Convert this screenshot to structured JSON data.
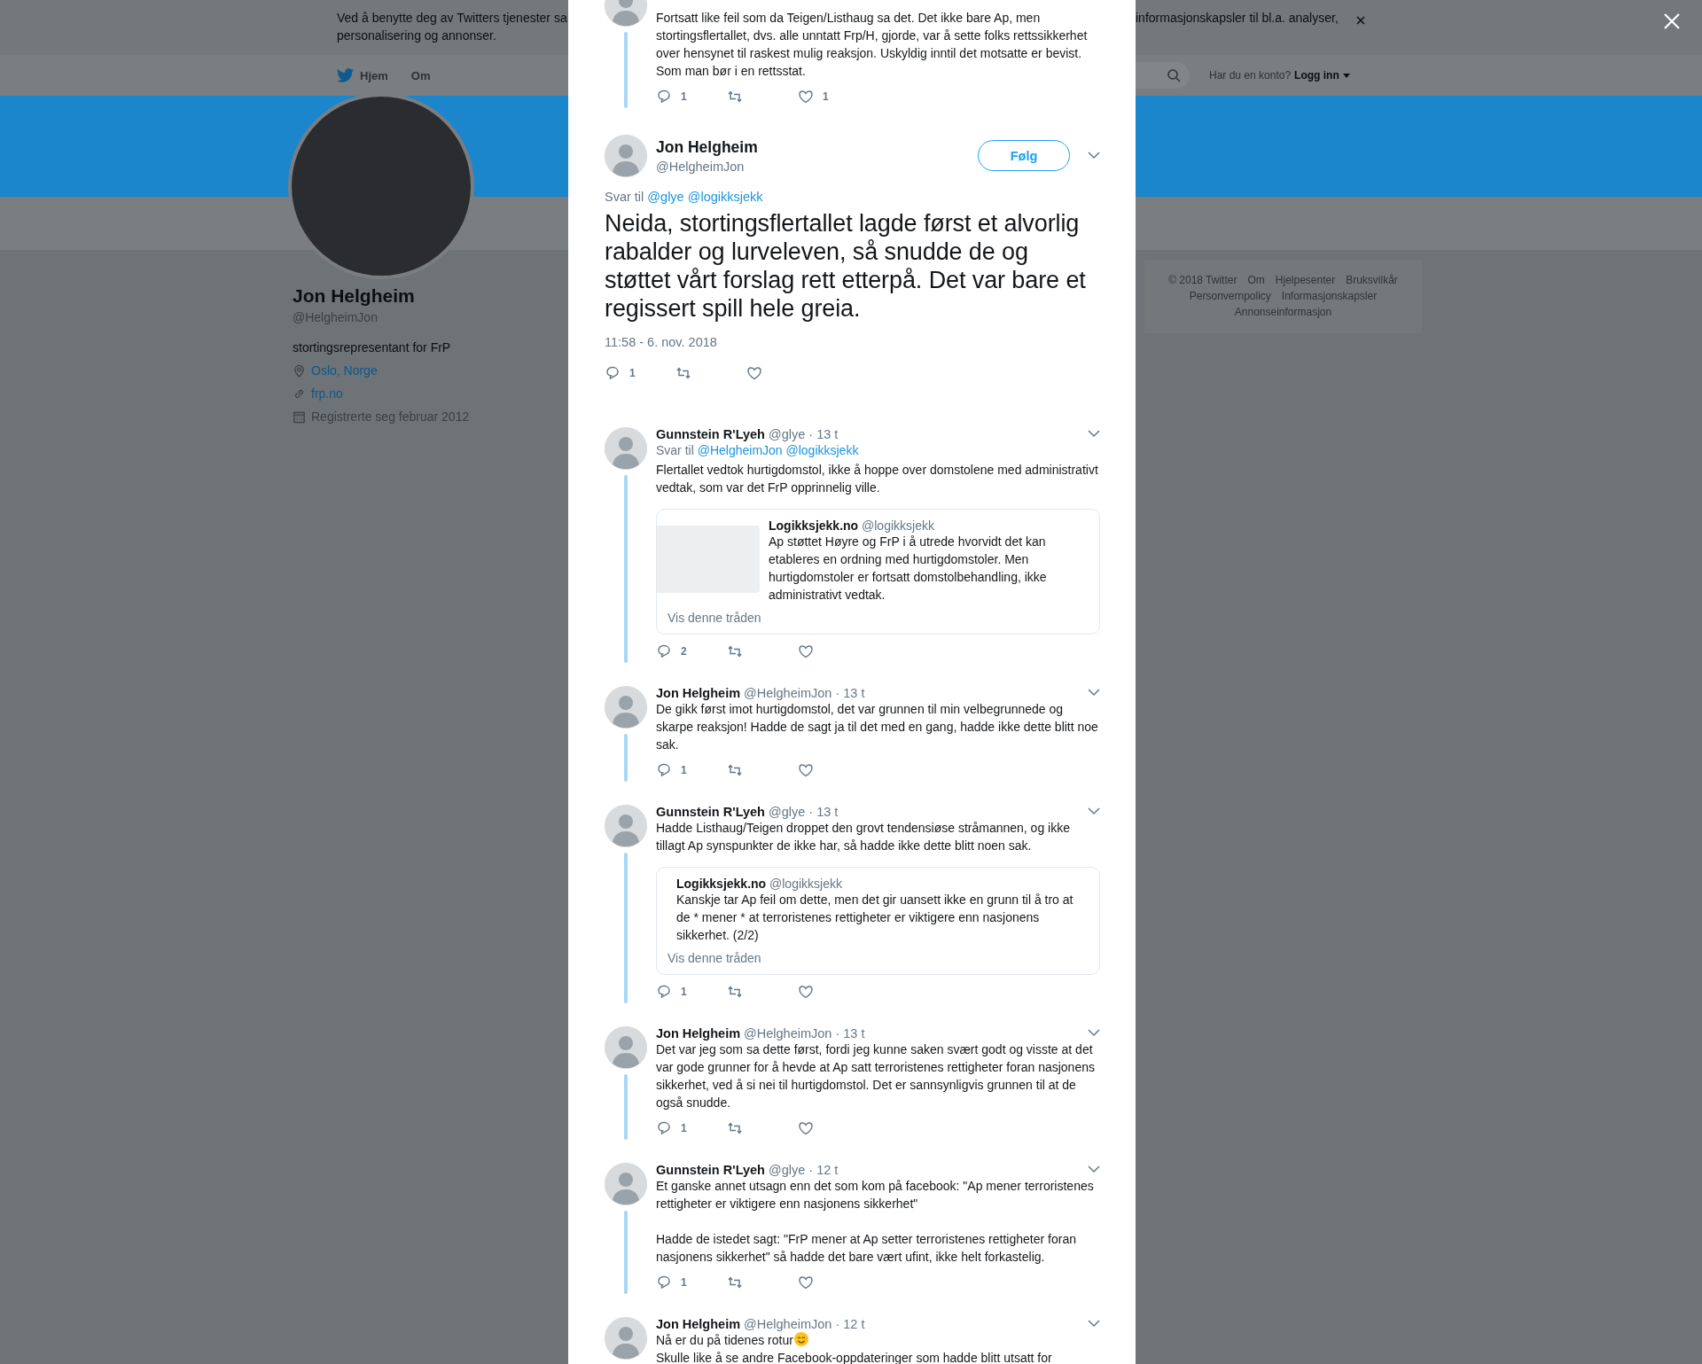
{
  "cookie_banner": {
    "text_left": "Ved å benytte deg av Twitters tjenester sa",
    "text_left_2": "personalisering og annonser.",
    "text_right": "informasjonskapsler til bl.a. analyser,"
  },
  "nav": {
    "items": [
      {
        "label": "Hjem",
        "kind": "home"
      },
      {
        "label": "Om",
        "kind": "plain"
      }
    ],
    "login_prompt": "Har du en konto?",
    "login": "Logg inn"
  },
  "profile": {
    "name": "Jon Helgheim",
    "handle": "@HelgheimJon",
    "bio": "stortingsrepresentant for FrP",
    "details": [
      {
        "kind": "location",
        "text": "Oslo, Norge"
      },
      {
        "kind": "link",
        "text": "frp.no"
      },
      {
        "kind": "joined",
        "text": "Registrerte seg februar 2012"
      }
    ]
  },
  "footer": {
    "links": [
      "© 2018 Twitter",
      "Om",
      "Hjelpesenter",
      "Bruksvilkår",
      "Personvernpolicy",
      "Informasjonskapsler",
      "Annonseinformasjon"
    ]
  },
  "conversation": {
    "parent_tweet": {
      "paragraphs": [
        "Fortsatt like feil som da Teigen/Listhaug sa det. Det ikke bare Ap, men stortingsflertallet, dvs. alle unntatt Frp/H, gjorde, var å sette folks rettssikkerhet over hensynet til raskest mulig reaksjon. Uskyldig inntil det motsatte er bevist. Som man bør i en rettsstat."
      ],
      "replies": "1",
      "likes": "1"
    },
    "main_tweet": {
      "name": "Jon Helgheim",
      "handle": "@HelgheimJon",
      "follow": "Følg",
      "reply_prefix": "Svar til",
      "mentions": [
        "@glye",
        "@logikksjekk"
      ],
      "text": "Neida, stortingsflertallet lagde først et alvorlig rabalder og lurveleven, så snudde de og støttet vårt forslag rett etterpå. Det var bare et regissert spill hele greia.",
      "timestamp": "11:58 - 6. nov. 2018",
      "replies": "1"
    },
    "replies": [
      {
        "name": "Gunnstein R'Lyeh",
        "handle": "@glye",
        "time": "· 13 t",
        "reply_prefix": "Svar til",
        "mentions": [
          "@HelgheimJon",
          "@logikksjekk"
        ],
        "paragraphs": [
          "Flertallet vedtok hurtigdomstol, ikke å hoppe over domstolene med administrativt vedtak, som var det FrP opprinnelig ville."
        ],
        "quote": {
          "name": "Logikksjekk.no",
          "handle": "@logikksjekk",
          "text": "Ap støttet Høyre og FrP i å utrede hvorvidt det kan etableres en ordning med hurtigdomstoler. Men hurtigdomstoler er fortsatt domstolbehandling, ikke administrativt vedtak.",
          "has_image": true,
          "link": "Vis denne tråden"
        },
        "replies": "2"
      },
      {
        "name": "Jon Helgheim",
        "handle": "@HelgheimJon",
        "time": "· 13 t",
        "paragraphs": [
          "De gikk først imot hurtigdomstol, det var grunnen til min velbegrunnede og skarpe reaksjon! Hadde de sagt ja til det med en gang, hadde ikke dette blitt noe sak."
        ],
        "replies": "1"
      },
      {
        "name": "Gunnstein R'Lyeh",
        "handle": "@glye",
        "time": "· 13 t",
        "paragraphs": [
          "Hadde Listhaug/Teigen droppet den grovt tendensiøse stråmannen, og ikke tillagt Ap synspunkter de ikke har, så hadde ikke dette blitt noen sak."
        ],
        "quote": {
          "name": "Logikksjekk.no",
          "handle": "@logikksjekk",
          "text": "Kanskje tar Ap feil om dette, men det gir uansett ikke en grunn til å tro at de * mener * at terroristenes rettigheter er viktigere enn nasjonens sikkerhet. (2/2)",
          "has_image": false,
          "link": "Vis denne tråden"
        },
        "replies": "1"
      },
      {
        "name": "Jon Helgheim",
        "handle": "@HelgheimJon",
        "time": "· 13 t",
        "paragraphs": [
          "Det var jeg som sa dette først, fordi jeg kunne saken svært godt og visste at det var gode grunner for å hevde at Ap satt terroristenes rettigheter foran nasjonens sikkerhet, ved å si nei til hurtigdomstol. Det er sannsynligvis grunnen til at de også snudde."
        ],
        "replies": "1"
      },
      {
        "name": "Gunnstein R'Lyeh",
        "handle": "@glye",
        "time": "· 12 t",
        "paragraphs": [
          "Et ganske annet utsagn enn det som kom på facebook: \"Ap mener terroristenes rettigheter er viktigere enn nasjonens sikkerhet\"",
          "Hadde de istedet sagt: \"FrP mener at Ap setter terroristenes rettigheter foran nasjonens sikkerhet\" så hadde det bare vært ufint, ikke helt forkastelig."
        ],
        "replies": "1"
      },
      {
        "name": "Jon Helgheim",
        "handle": "@HelgheimJon",
        "time": "· 12 t",
        "lines": [
          {
            "text": "Nå er du på tidenes rotur",
            "smiley": true
          },
          {
            "text": "Skulle like å se andre Facebook-oppdateringer som hadde blitt utsatt for",
            "smiley": false
          }
        ]
      }
    ]
  }
}
